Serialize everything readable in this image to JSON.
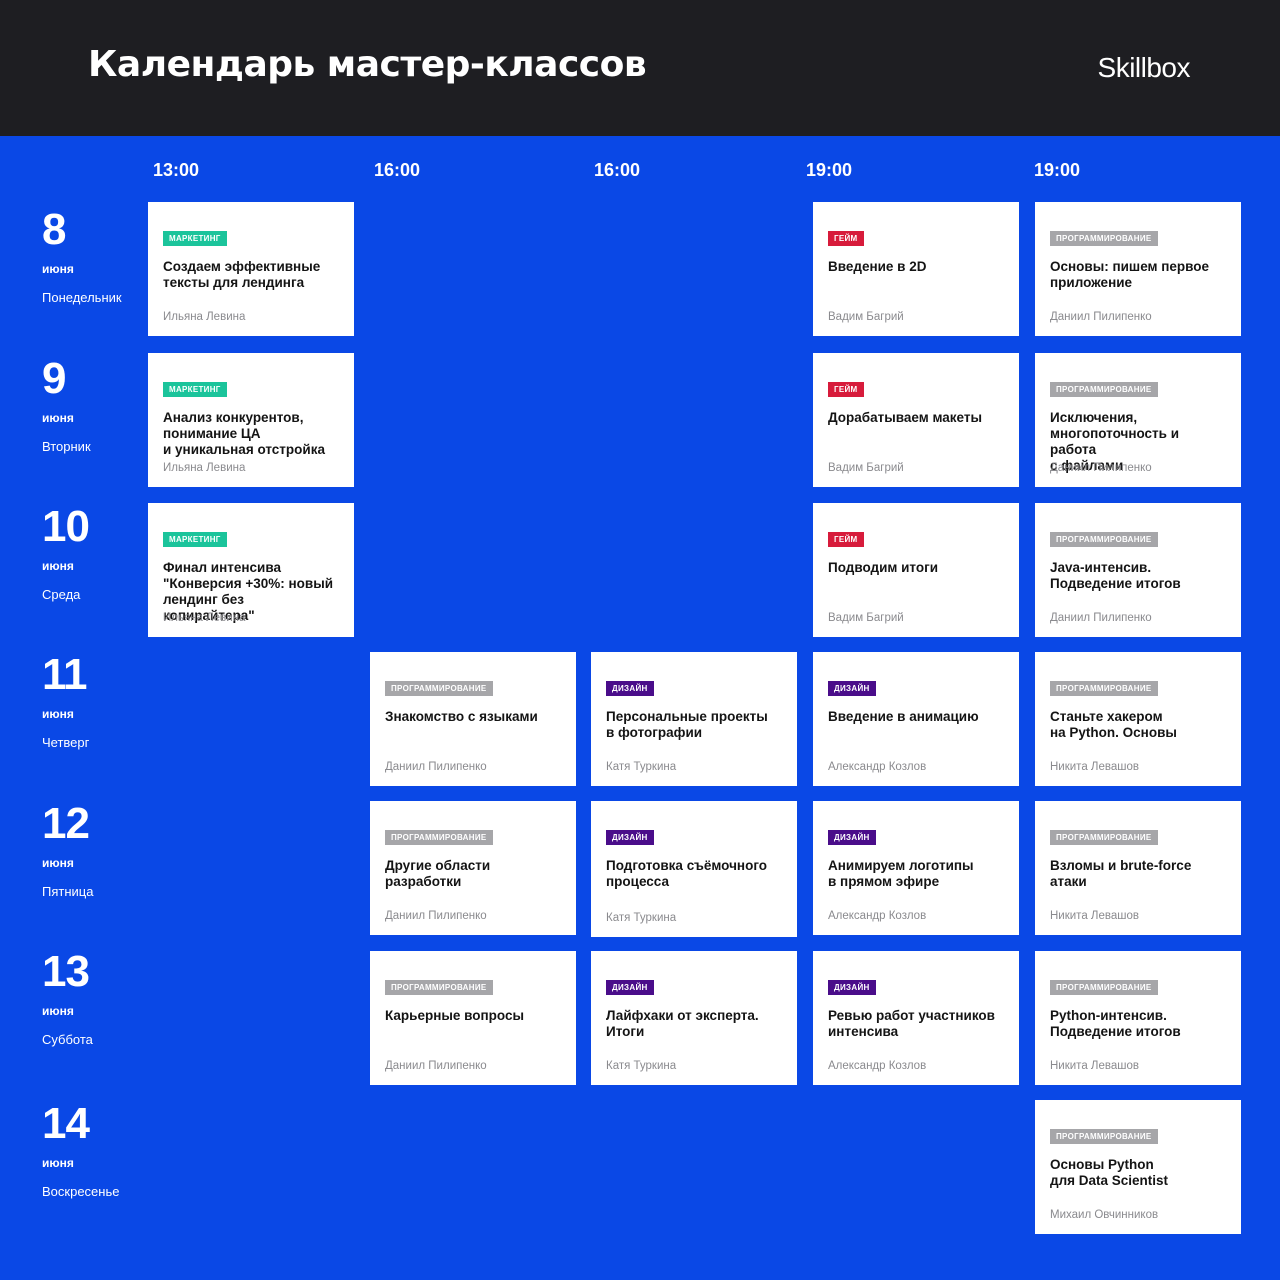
{
  "header": {
    "title": "Календарь мастер-классов",
    "logo": "Skillbox"
  },
  "times": [
    "13:00",
    "16:00",
    "16:00",
    "19:00",
    "19:00"
  ],
  "days": [
    {
      "num": "8",
      "month": "июня",
      "weekday": "Понедельник"
    },
    {
      "num": "9",
      "month": "июня",
      "weekday": "Вторник"
    },
    {
      "num": "10",
      "month": "июня",
      "weekday": "Среда"
    },
    {
      "num": "11",
      "month": "июня",
      "weekday": "Четверг"
    },
    {
      "num": "12",
      "month": "июня",
      "weekday": "Пятница"
    },
    {
      "num": "13",
      "month": "июня",
      "weekday": "Суббота"
    },
    {
      "num": "14",
      "month": "июня",
      "weekday": "Воскресенье"
    }
  ],
  "tag_colors": {
    "marketing": "#1bc49b",
    "game": "#d71b3b",
    "prog": "#a6a6a9",
    "design": "#4a0d8a"
  },
  "cards": {
    "d8_c1": {
      "tag": "МАРКЕТИНГ",
      "title": "Создаем эффективные\nтексты для лендинга",
      "author": "Ильяна Левина"
    },
    "d8_c4": {
      "tag": "ГЕЙМ",
      "title": "Введение в 2D",
      "author": "Вадим Багрий"
    },
    "d8_c5": {
      "tag": "ПРОГРАММИРОВАНИЕ",
      "title": "Основы: пишем первое\nприложение",
      "author": "Даниил Пилипенко"
    },
    "d9_c1": {
      "tag": "МАРКЕТИНГ",
      "title": "Анализ конкурентов,\nпонимание ЦА\nи уникальная отстройка",
      "author": "Ильяна Левина"
    },
    "d9_c4": {
      "tag": "ГЕЙМ",
      "title": "Дорабатываем макеты",
      "author": "Вадим Багрий"
    },
    "d9_c5": {
      "tag": "ПРОГРАММИРОВАНИЕ",
      "title": "Исключения,\nмногопоточность и работа\nс файлами",
      "author": "Даниил Пилипенко"
    },
    "d10_c1": {
      "tag": "МАРКЕТИНГ",
      "title": "Финал интенсива\n\"Конверсия +30%: новый\nлендинг без копирайтера\"",
      "author": "Ильяна Левина"
    },
    "d10_c4": {
      "tag": "ГЕЙМ",
      "title": "Подводим итоги",
      "author": "Вадим Багрий"
    },
    "d10_c5": {
      "tag": "ПРОГРАММИРОВАНИЕ",
      "title": "Java-интенсив.\nПодведение итогов",
      "author": "Даниил Пилипенко"
    },
    "d11_c2": {
      "tag": "ПРОГРАММИРОВАНИЕ",
      "title": "Знакомство с языками",
      "author": "Даниил Пилипенко"
    },
    "d11_c3": {
      "tag": "ДИЗАЙН",
      "title": "Персональные проекты\nв фотографии",
      "author": "Катя Туркина"
    },
    "d11_c4": {
      "tag": "ДИЗАЙН",
      "title": "Введение в анимацию",
      "author": "Александр Козлов"
    },
    "d11_c5": {
      "tag": "ПРОГРАММИРОВАНИЕ",
      "title": "Станьте хакером\nна Python. Основы",
      "author": "Никита Левашов"
    },
    "d12_c2": {
      "tag": "ПРОГРАММИРОВАНИЕ",
      "title": "Другие области\nразработки",
      "author": "Даниил Пилипенко"
    },
    "d12_c3": {
      "tag": "ДИЗАЙН",
      "title": "Подготовка съёмочного\nпроцесса",
      "author": "Катя Туркина"
    },
    "d12_c4": {
      "tag": "ДИЗАЙН",
      "title": "Анимируем логотипы\nв прямом эфире",
      "author": "Александр Козлов"
    },
    "d12_c5": {
      "tag": "ПРОГРАММИРОВАНИЕ",
      "title": "Взломы и brute-force\nатаки",
      "author": "Никита Левашов"
    },
    "d13_c2": {
      "tag": "ПРОГРАММИРОВАНИЕ",
      "title": "Карьерные вопросы",
      "author": "Даниил Пилипенко"
    },
    "d13_c3": {
      "tag": "ДИЗАЙН",
      "title": "Лайфхаки от эксперта.\nИтоги",
      "author": "Катя Туркина"
    },
    "d13_c4": {
      "tag": "ДИЗАЙН",
      "title": "Ревью работ участников\nинтенсива",
      "author": "Александр Козлов"
    },
    "d13_c5": {
      "tag": "ПРОГРАММИРОВАНИЕ",
      "title": "Python-интенсив.\nПодведение итогов",
      "author": "Никита Левашов"
    },
    "d14_c5": {
      "tag": "ПРОГРАММИРОВАНИЕ",
      "title": "Основы Python\nдля Data Scientist",
      "author": "Михаил Овчинников"
    }
  }
}
